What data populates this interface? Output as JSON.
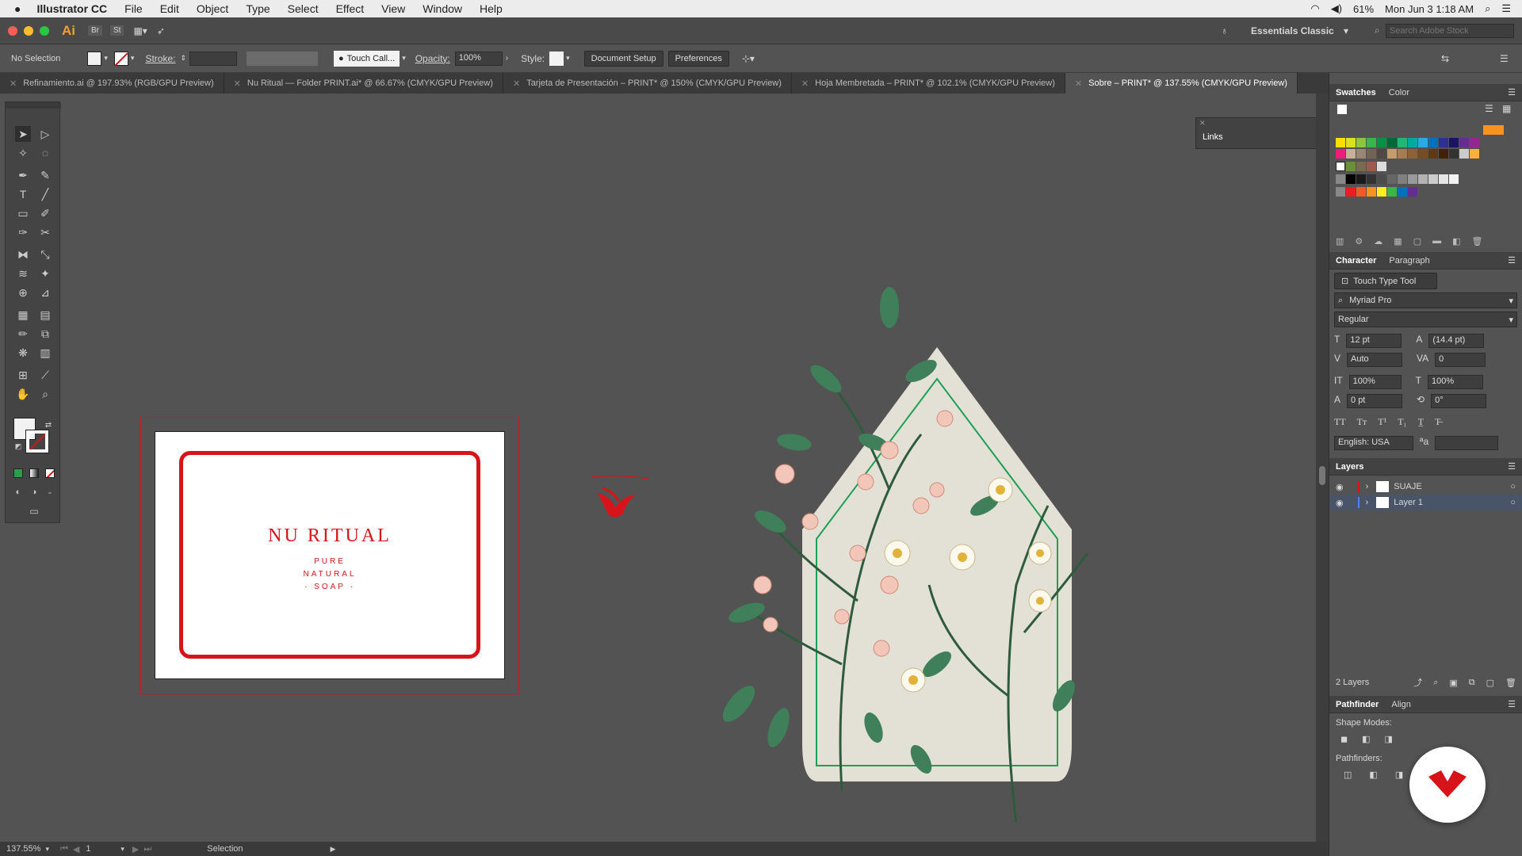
{
  "menubar": {
    "app": "Illustrator CC",
    "items": [
      "File",
      "Edit",
      "Object",
      "Type",
      "Select",
      "Effect",
      "View",
      "Window",
      "Help"
    ],
    "battery": "61%",
    "clock": "Mon Jun 3  1:18 AM"
  },
  "appbar": {
    "logo": "Ai",
    "workspace": "Essentials Classic",
    "search_placeholder": "Search Adobe Stock"
  },
  "control": {
    "selection": "No Selection",
    "stroke_label": "Stroke:",
    "brush": "Touch Call...",
    "opacity_label": "Opacity:",
    "opacity": "100%",
    "style_label": "Style:",
    "doc_setup": "Document Setup",
    "preferences": "Preferences"
  },
  "tabs": [
    {
      "label": "Refinamiento.ai @ 197.93% (RGB/GPU Preview)",
      "active": false
    },
    {
      "label": "Nu Ritual — Folder PRINT.ai* @ 66.67% (CMYK/GPU Preview)",
      "active": false
    },
    {
      "label": "Tarjeta de Presentación – PRINT* @ 150% (CMYK/GPU Preview)",
      "active": false
    },
    {
      "label": "Hoja Membretada – PRINT* @ 102.1% (CMYK/GPU Preview)",
      "active": false
    },
    {
      "label": "Sobre – PRINT* @ 137.55% (CMYK/GPU Preview)",
      "active": true
    }
  ],
  "card": {
    "brand": "NU RITUAL",
    "tag1": "PURE",
    "tag2": "NATURAL",
    "tag3": "· SOAP ·"
  },
  "panels": {
    "swatches_tab": "Swatches",
    "color_tab": "Color",
    "links_title": "Links",
    "character_tab": "Character",
    "paragraph_tab": "Paragraph",
    "touch_type": "Touch Type Tool",
    "font": "Myriad Pro",
    "style": "Regular",
    "size": "12 pt",
    "leading": "(14.4 pt)",
    "kerning": "Auto",
    "tracking": "0",
    "vscale": "100%",
    "hscale": "100%",
    "baseline": "0 pt",
    "rotation": "0°",
    "language": "English: USA",
    "layers_tab": "Layers",
    "layer1": "SUAJE",
    "layer2": "Layer 1",
    "layer_count": "2 Layers",
    "pathfinder_tab": "Pathfinder",
    "align_tab": "Align",
    "shape_modes": "Shape Modes:",
    "pathfinders": "Pathfinders:"
  },
  "status": {
    "zoom": "137.55%",
    "page": "1",
    "tool": "Selection"
  },
  "colors": {
    "brand_red": "#d7141a",
    "envelope": "#e3e1d6",
    "leaf": "#2f7a52"
  }
}
